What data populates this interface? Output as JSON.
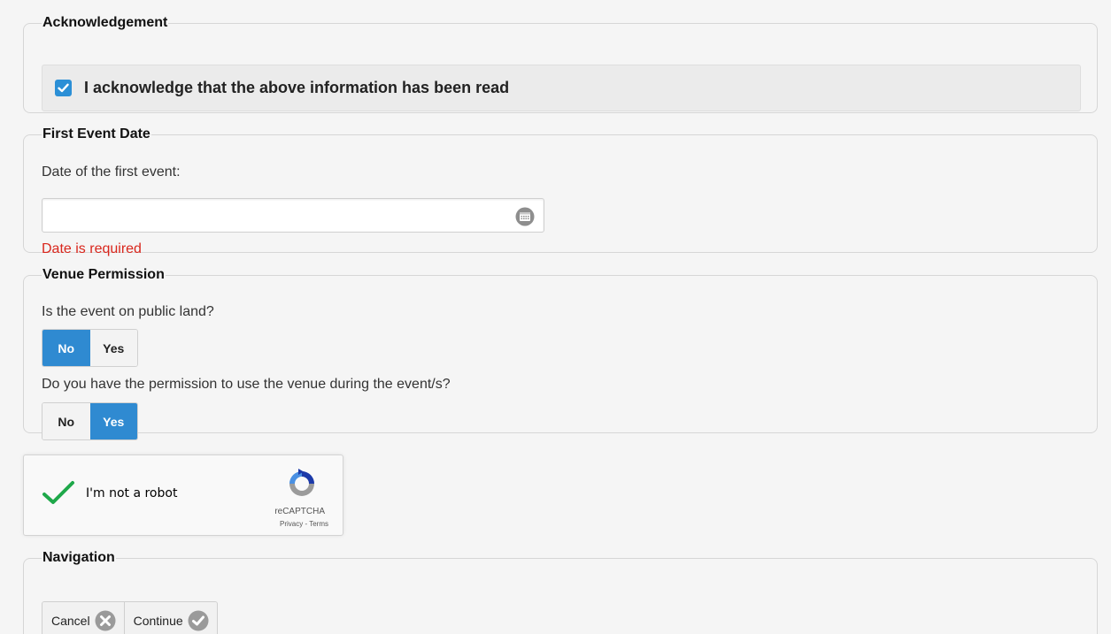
{
  "acknowledgement": {
    "legend": "Acknowledgement",
    "checkbox_checked": true,
    "text": "I acknowledge that the above information has been read"
  },
  "first_event_date": {
    "legend": "First Event Date",
    "label": "Date of the first event:",
    "value": "",
    "error": "Date is required"
  },
  "venue_permission": {
    "legend": "Venue Permission",
    "q1": {
      "label": "Is the event on public land?",
      "no": "No",
      "yes": "Yes",
      "selected": "No"
    },
    "q2": {
      "label": "Do you have the permission to use the venue during the event/s?",
      "no": "No",
      "yes": "Yes",
      "selected": "Yes"
    }
  },
  "recaptcha": {
    "label": "I'm not a robot",
    "brand": "reCAPTCHA",
    "links": "Privacy - Terms",
    "verified": true
  },
  "navigation": {
    "legend": "Navigation",
    "cancel": "Cancel",
    "continue": "Continue"
  },
  "colors": {
    "accent": "#2f8ad1",
    "error": "#d9261c",
    "check_green": "#1fa84a"
  }
}
